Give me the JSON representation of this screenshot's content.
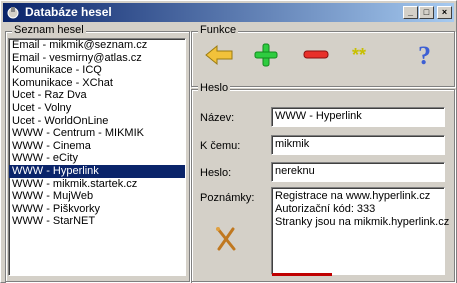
{
  "window": {
    "title": "Databáze hesel",
    "icon": "app-icon",
    "controls": {
      "minimize": "_",
      "maximize": "□",
      "close": "×"
    }
  },
  "left_panel": {
    "group_label": "Seznam hesel",
    "items": [
      "Email - mikmik@seznam.cz",
      "Email - vesmirny@atlas.cz",
      "Komunikace - ICQ",
      "Komunikace - XChat",
      "Ucet - Raz Dva",
      "Ucet - Volny",
      "Ucet - WorldOnLine",
      "WWW - Centrum - MIKMIK",
      "WWW - Cinema",
      "WWW - eCity",
      "WWW - Hyperlink",
      "WWW - mikmik.startek.cz",
      "WWW - MujWeb",
      "WWW - Piškvorky",
      "WWW - StarNET"
    ],
    "selected_index": 10
  },
  "functions": {
    "group_label": "Funkce",
    "buttons": [
      {
        "icon": "back-arrow-icon",
        "color": "#f2c23a"
      },
      {
        "icon": "plus-icon",
        "color": "#2ecc40"
      },
      {
        "icon": "minus-icon",
        "color": "#e8302a"
      },
      {
        "icon": "asterisks-icon",
        "color": "#c8c000"
      },
      {
        "icon": "help-icon",
        "color": "#3d5fd4"
      }
    ]
  },
  "detail": {
    "group_label": "Heslo",
    "name_label": "Název:",
    "name_value": "WWW - Hyperlink",
    "forwhat_label": "K čemu:",
    "forwhat_value": "mikmik",
    "password_label": "Heslo:",
    "password_value": "nereknu",
    "notes_label": "Poznámky:",
    "notes_lines": [
      "Registrace na www.hyperlink.cz",
      "Autorizační kód: 333",
      "Stranky jsou na mikmik.hyperlink.cz"
    ],
    "tool_icon": "tools-icon"
  }
}
